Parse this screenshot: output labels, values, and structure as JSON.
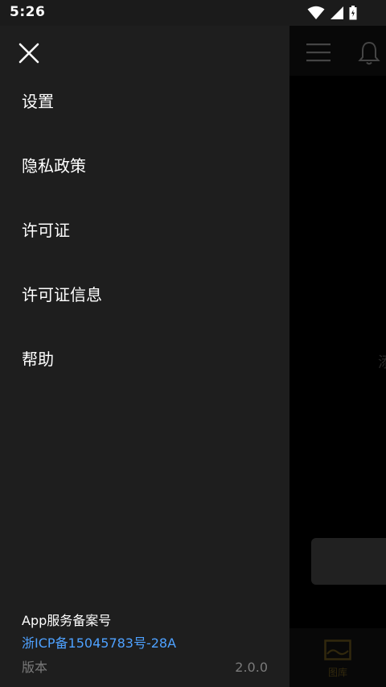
{
  "status_bar": {
    "time": "5:26",
    "icons": [
      "wifi-icon",
      "cell-signal-icon",
      "battery-icon"
    ]
  },
  "drawer": {
    "close_icon": "close-icon",
    "menu_items": [
      {
        "label": "设置"
      },
      {
        "label": "隐私政策"
      },
      {
        "label": "许可证"
      },
      {
        "label": "许可证信息"
      },
      {
        "label": "帮助"
      }
    ],
    "footer": {
      "icp_title": "App服务备案号",
      "icp_number": "浙ICP备15045783号-28A",
      "version_label": "版本",
      "version_value": "2.0.0"
    }
  },
  "background_app": {
    "side_text": "添",
    "bottom_nav": {
      "gallery_label": "图库"
    }
  },
  "colors": {
    "drawer_bg": "#1e1e1e",
    "link": "#4ea1ff",
    "muted_text": "#7a7a7a",
    "accent_gold": "#6e5a1e"
  }
}
